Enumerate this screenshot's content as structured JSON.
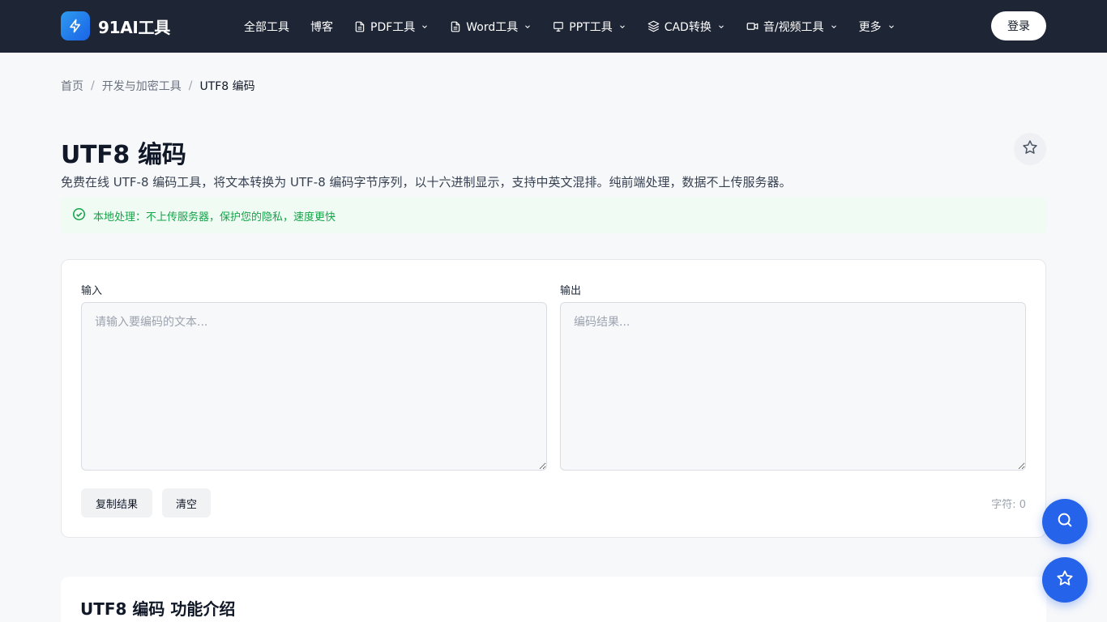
{
  "brand": {
    "name": "91AI工具",
    "icon": "lightning-icon",
    "accent": "#2563eb"
  },
  "nav": {
    "items": [
      {
        "label": "全部工具"
      },
      {
        "label": "博客"
      },
      {
        "label": "PDF工具",
        "icon": "document-icon",
        "dropdown": true
      },
      {
        "label": "Word工具",
        "icon": "document-icon",
        "dropdown": true
      },
      {
        "label": "PPT工具",
        "icon": "presentation-icon",
        "dropdown": true
      },
      {
        "label": "CAD转换",
        "icon": "layers-icon",
        "dropdown": true
      },
      {
        "label": "音/视频工具",
        "icon": "video-icon",
        "dropdown": true
      },
      {
        "label": "更多",
        "dropdown": true
      }
    ],
    "login_label": "登录"
  },
  "breadcrumb": {
    "home": "首页",
    "category": "开发与加密工具",
    "current": "UTF8 编码"
  },
  "page": {
    "title": "UTF8 编码",
    "description": "免费在线 UTF-8 编码工具，将文本转换为 UTF-8 编码字节序列，以十六进制显示，支持中英文混排。纯前端处理，数据不上传服务器。",
    "notice": "本地处理：不上传服务器，保护您的隐私，速度更快"
  },
  "tool": {
    "input_label": "输入",
    "input_placeholder": "请输入要编码的文本...",
    "input_value": "",
    "output_label": "输出",
    "output_placeholder": "编码结果...",
    "output_value": "",
    "copy_label": "复制结果",
    "clear_label": "清空",
    "char_count": "字符: 0"
  },
  "intro": {
    "title": "UTF8 编码 功能介绍"
  },
  "fab": {
    "search_icon": "search-icon",
    "favorite_icon": "star-icon"
  }
}
